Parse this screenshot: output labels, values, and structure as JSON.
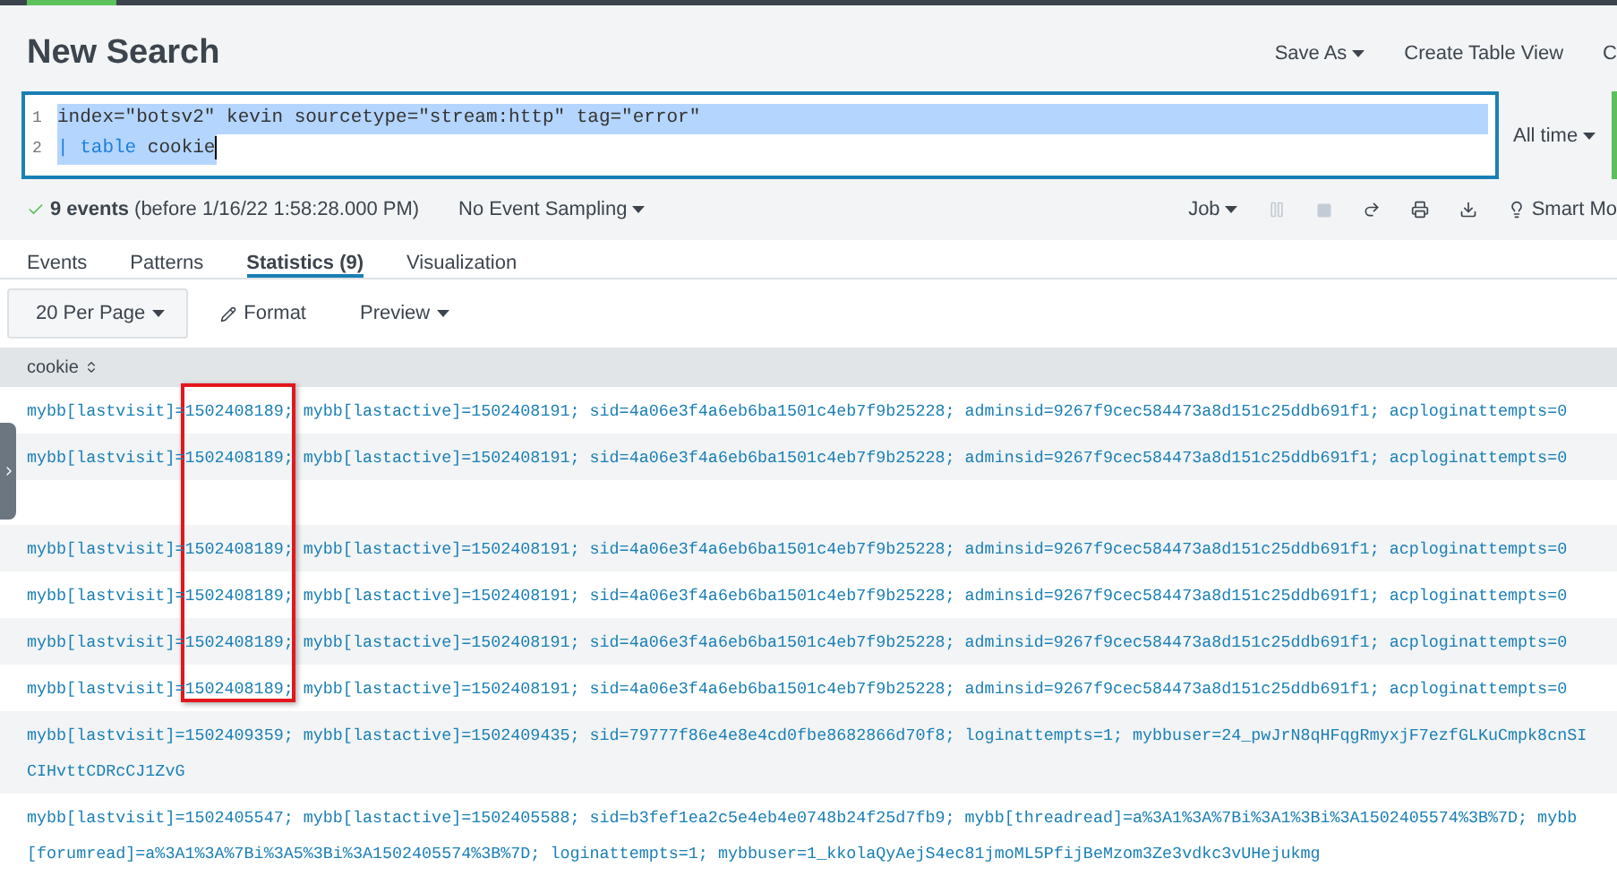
{
  "title": "New Search",
  "header_actions": [
    {
      "label": "Save As",
      "dropdown": true
    },
    {
      "label": "Create Table View",
      "dropdown": false
    },
    {
      "label": "C",
      "dropdown": false
    }
  ],
  "search": {
    "lines": [
      {
        "number": "1",
        "selected": true,
        "tokens": [
          {
            "kind": "text",
            "text": "index=\"botsv2\" kevin sourcetype=\"stream:http\" tag=\"error\""
          }
        ]
      },
      {
        "number": "2",
        "selected": true,
        "tokens": [
          {
            "kind": "keyword",
            "text": "| table"
          },
          {
            "kind": "text",
            "text": " cookie"
          }
        ]
      }
    ],
    "time_range": "All time"
  },
  "status": {
    "count": "9 events",
    "detail": "(before 1/16/22 1:58:28.000 PM)",
    "sampling": "No Event Sampling",
    "job": "Job",
    "smart_mode": "Smart Mo"
  },
  "tabs": [
    {
      "label": "Events",
      "selected": false
    },
    {
      "label": "Patterns",
      "selected": false
    },
    {
      "label": "Statistics (9)",
      "selected": true
    },
    {
      "label": "Visualization",
      "selected": false
    }
  ],
  "toolbar": {
    "per_page": "20 Per Page",
    "format": "Format",
    "preview": "Preview"
  },
  "table": {
    "columns": [
      "cookie"
    ],
    "rows": [
      {
        "cookie": "mybb[lastvisit]=1502408189; mybb[lastactive]=1502408191; sid=4a06e3f4a6eb6ba1501c4eb7f9b25228; adminsid=9267f9cec584473a8d151c25ddb691f1; acploginattempts=0"
      },
      {
        "cookie": "mybb[lastvisit]=1502408189; mybb[lastactive]=1502408191; sid=4a06e3f4a6eb6ba1501c4eb7f9b25228; adminsid=9267f9cec584473a8d151c25ddb691f1; acploginattempts=0"
      },
      {},
      {
        "cookie": "mybb[lastvisit]=1502408189; mybb[lastactive]=1502408191; sid=4a06e3f4a6eb6ba1501c4eb7f9b25228; adminsid=9267f9cec584473a8d151c25ddb691f1; acploginattempts=0"
      },
      {
        "cookie": "mybb[lastvisit]=1502408189; mybb[lastactive]=1502408191; sid=4a06e3f4a6eb6ba1501c4eb7f9b25228; adminsid=9267f9cec584473a8d151c25ddb691f1; acploginattempts=0"
      },
      {
        "cookie": "mybb[lastvisit]=1502408189; mybb[lastactive]=1502408191; sid=4a06e3f4a6eb6ba1501c4eb7f9b25228; adminsid=9267f9cec584473a8d151c25ddb691f1; acploginattempts=0"
      },
      {
        "cookie": "mybb[lastvisit]=1502408189; mybb[lastactive]=1502408191; sid=4a06e3f4a6eb6ba1501c4eb7f9b25228; adminsid=9267f9cec584473a8d151c25ddb691f1; acploginattempts=0"
      },
      {
        "cookie": "mybb[lastvisit]=1502409359; mybb[lastactive]=1502409435; sid=79777f86e4e8e4cd0fbe8682866d70f8; loginattempts=1; mybbuser=24_pwJrN8qHFqgRmyxjF7ezfGLKuCmpk8cnSICIHvttCDRcCJ1ZvG"
      },
      {
        "cookie": "mybb[lastvisit]=1502405547; mybb[lastactive]=1502405588; sid=b3fef1ea2c5e4eb4e0748b24f25d7fb9; mybb[threadread]=a%3A1%3A%7Bi%3A1%3Bi%3A1502405574%3B%7D; mybb[forumread]=a%3A1%3A%7Bi%3A5%3Bi%3A1502405574%3B%7D; loginattempts=1; mybbuser=1_kkolaQyAejS4ec81jmoML5PfijBeMzom3Ze3vdkc3vUHejukmg"
      }
    ]
  }
}
